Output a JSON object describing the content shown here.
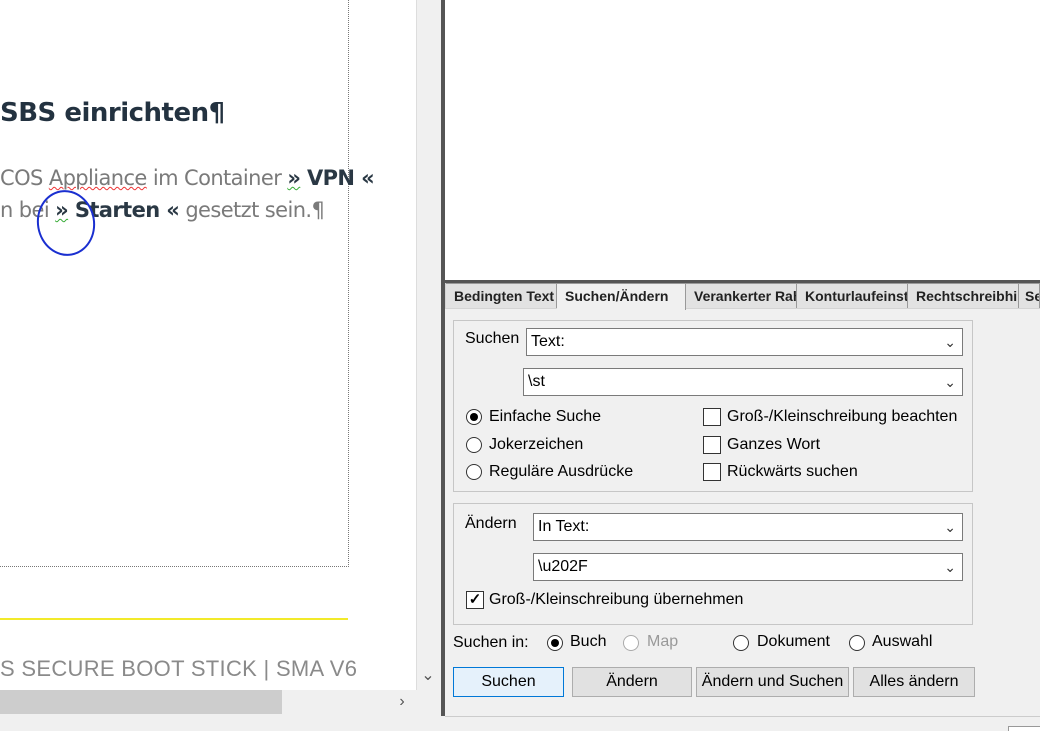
{
  "document": {
    "heading": "SBS einrichten¶",
    "line1_a": "COS ",
    "line1_b": "Appliance",
    "line1_c": " im Container ",
    "line1_d": "»",
    "line1_e": " VPN «",
    "line2_a": "n bei ",
    "line2_b": "»",
    "line2_c": " Starten «",
    "line2_d": " gesetzt sein.¶",
    "footer": "S SECURE BOOT STICK | SMA V6"
  },
  "tabs": [
    {
      "label": "Bedingten Text"
    },
    {
      "label": "Suchen/Ändern"
    },
    {
      "label": "Verankerter Rahmen"
    },
    {
      "label": "Konturlaufeinstellungen"
    },
    {
      "label": "Rechtschreibhilfe"
    },
    {
      "label": "Se"
    }
  ],
  "search": {
    "label": "Suchen",
    "mode_value": "Text:",
    "query_value": "\\st",
    "options": {
      "simple": "Einfache Suche",
      "wildcard": "Jokerzeichen",
      "regex": "Reguläre Ausdrücke",
      "case": "Groß-/Kleinschreibung beachten",
      "whole": "Ganzes Wort",
      "backwards": "Rückwärts suchen"
    }
  },
  "replace": {
    "label": "Ändern",
    "mode_value": "In Text:",
    "replace_value": "\\u202F",
    "keep_case": "Groß-/Kleinschreibung übernehmen"
  },
  "scope": {
    "label": "Suchen in:",
    "book": "Buch",
    "map": "Map",
    "document": "Dokument",
    "selection": "Auswahl"
  },
  "buttons": {
    "find": "Suchen",
    "change": "Ändern",
    "change_find": "Ändern und Suchen",
    "change_all": "Alles ändern"
  },
  "icons": {
    "chevron": "chevron-down-icon",
    "scroll_right": "chevron-right-icon",
    "scroll_down": "chevron-down-icon"
  }
}
